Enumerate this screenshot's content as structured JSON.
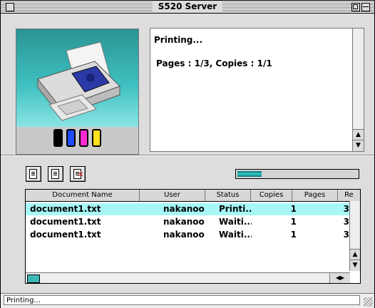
{
  "window": {
    "title": "S520 Server"
  },
  "message": {
    "line1": "Printing...",
    "line2": "Pages : 1/3, Copies : 1/1"
  },
  "ink_colors": [
    "#000000",
    "#1e4bff",
    "#ff2bd0",
    "#ffe21c"
  ],
  "toolbar": {
    "buttons": [
      "print-now-icon",
      "hold-icon",
      "delete-icon"
    ],
    "progress_fraction": 0.2
  },
  "table": {
    "headers": [
      "Document Name",
      "User",
      "Status",
      "Copies",
      "Pages",
      "Re"
    ],
    "rows": [
      {
        "name": "document1.txt",
        "user": "nakanoo",
        "status": "Printi...",
        "copies": "1",
        "pages": "3"
      },
      {
        "name": "document1.txt",
        "user": "nakanoo",
        "status": "Waiti...",
        "copies": "1",
        "pages": "3"
      },
      {
        "name": "document1.txt",
        "user": "nakanoo",
        "status": "Waiti...",
        "copies": "1",
        "pages": "3"
      }
    ]
  },
  "status_bar": {
    "text": "Printing..."
  },
  "scroll": {
    "up": "▲",
    "down": "▼",
    "left": "◀",
    "right": "▶"
  }
}
